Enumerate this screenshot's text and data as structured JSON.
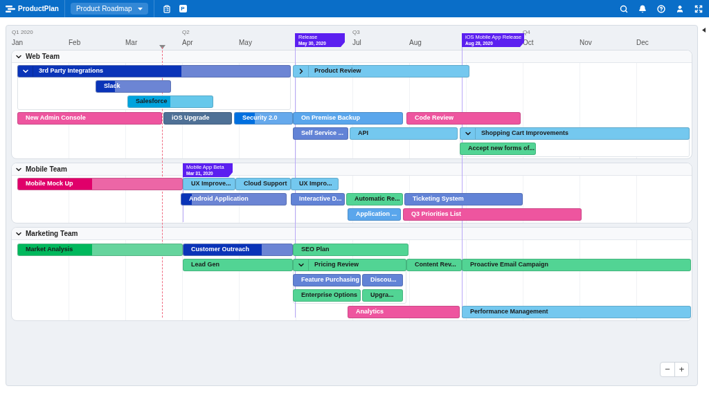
{
  "app": {
    "logo": "ProductPlan",
    "roadmap": "Product Roadmap",
    "badge": "P"
  },
  "timeline": {
    "quarters": [
      "Q1 2020",
      "Q2",
      "Q3",
      "Q4"
    ],
    "months": [
      "Jan",
      "Feb",
      "Mar",
      "Apr",
      "May",
      "Jul",
      "Aug",
      "Oct",
      "Nov",
      "Dec"
    ]
  },
  "milestones": [
    {
      "title": "Release",
      "date": "May 30, 2020"
    },
    {
      "title": "iOS Mobile App Release",
      "date": "Aug 28, 2020"
    },
    {
      "title": "Mobile App Beta",
      "date": "Mar 31, 2020"
    }
  ],
  "lanes": [
    {
      "name": "Web Team",
      "expanded": true,
      "bars": [
        {
          "kind": "container",
          "label": "3rd Party Integrations",
          "color": "#0a34b8",
          "level": 0.6,
          "expanded": true,
          "children": [
            {
              "kind": "bar",
              "label": "Slack",
              "color": "#0a34b8",
              "level": 0.25
            },
            {
              "kind": "bar",
              "label": "Salesforce",
              "color": "#00a3dd",
              "level": 0.5
            }
          ]
        },
        {
          "kind": "container",
          "label": "Product Review",
          "color": "#74c8ef",
          "expanded": false
        },
        {
          "kind": "bar",
          "label": "New Admin Console",
          "color": "#ee559f"
        },
        {
          "kind": "bar",
          "label": "iOS Upgrade",
          "color": "#4f7196"
        },
        {
          "kind": "bar",
          "label": "Security 2.0",
          "color": "#0070e0",
          "level": 0.35
        },
        {
          "kind": "bar",
          "label": "On Premise Backup",
          "color": "#5aa6ec"
        },
        {
          "kind": "bar",
          "label": "Code Review",
          "color": "#ee559f"
        },
        {
          "kind": "bar",
          "label": "Self Service ...",
          "color": "#6283d6"
        },
        {
          "kind": "bar",
          "label": "API",
          "color": "#74c8ef"
        },
        {
          "kind": "container",
          "label": "Shopping Cart Improvements",
          "color": "#74c8ef",
          "expanded": true,
          "children": [
            {
              "kind": "bar",
              "label": "Accept new forms of...",
              "color": "#52d494"
            }
          ]
        }
      ]
    },
    {
      "name": "Mobile Team",
      "expanded": true,
      "bars": [
        {
          "kind": "bar",
          "label": "Mobile Mock Up",
          "color": "#e0006a",
          "level": 0.45
        },
        {
          "kind": "bar",
          "label": "UX Improve...",
          "color": "#74c8ef"
        },
        {
          "kind": "bar",
          "label": "Cloud Support",
          "color": "#74c8ef"
        },
        {
          "kind": "bar",
          "label": "UX Impro...",
          "color": "#74c8ef"
        },
        {
          "kind": "bar",
          "label": "Android Application",
          "color": "#0a34b8",
          "level": 0.1
        },
        {
          "kind": "bar",
          "label": "Interactive D...",
          "color": "#6283d6"
        },
        {
          "kind": "bar",
          "label": "Automatic Re...",
          "color": "#52d494"
        },
        {
          "kind": "bar",
          "label": "Ticketing System",
          "color": "#6283d6"
        },
        {
          "kind": "bar",
          "label": "Application ...",
          "color": "#5aa6ec"
        },
        {
          "kind": "bar",
          "label": "Q3 Priorities List",
          "color": "#ee559f"
        }
      ]
    },
    {
      "name": "Marketing Team",
      "expanded": true,
      "bars": [
        {
          "kind": "bar",
          "label": "Market Analysis",
          "color": "#00b85c",
          "level": 0.45
        },
        {
          "kind": "bar",
          "label": "Customer Outreach",
          "color": "#0a34b8",
          "level": 0.72
        },
        {
          "kind": "bar",
          "label": "SEO Plan",
          "color": "#52d494"
        },
        {
          "kind": "bar",
          "label": "Lead Gen",
          "color": "#52d494"
        },
        {
          "kind": "container",
          "label": "Pricing Review",
          "color": "#52d494",
          "expanded": true,
          "children": [
            {
              "kind": "bar",
              "label": "Feature Purchasing",
              "color": "#6283d6"
            },
            {
              "kind": "bar",
              "label": "Discou...",
              "color": "#6283d6"
            },
            {
              "kind": "bar",
              "label": "Enterprise Options",
              "color": "#52d494"
            },
            {
              "kind": "bar",
              "label": "Upgra...",
              "color": "#52d494"
            }
          ]
        },
        {
          "kind": "bar",
          "label": "Content Rev...",
          "color": "#52d494"
        },
        {
          "kind": "bar",
          "label": "Proactive Email Campaign",
          "color": "#52d494"
        },
        {
          "kind": "bar",
          "label": "Analytics",
          "color": "#ee559f"
        },
        {
          "kind": "bar",
          "label": "Performance Management",
          "color": "#74c8ef"
        }
      ]
    }
  ],
  "zoom": [
    "−",
    "+"
  ]
}
